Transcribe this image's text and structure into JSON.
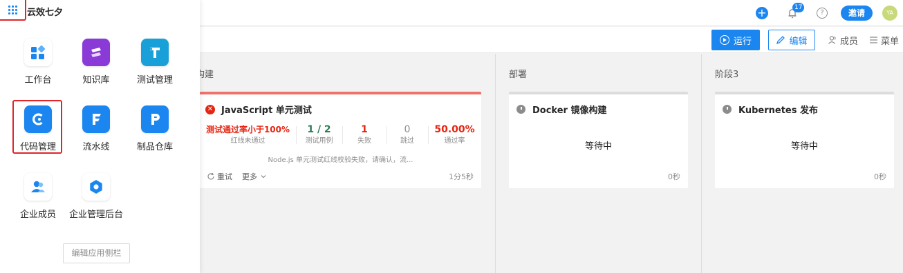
{
  "app": {
    "brand": "云效七夕"
  },
  "topbar": {
    "notification_count": "17",
    "help_glyph": "?",
    "invite_label": "邀请",
    "avatar_initials": "YA"
  },
  "toolbar": {
    "run_label": "运行",
    "edit_label": "编辑",
    "members_label": "成员",
    "menu_label": "菜单"
  },
  "drawer": {
    "apps": [
      {
        "label": "工作台",
        "icon": "workbench-icon"
      },
      {
        "label": "知识库",
        "icon": "knowledge-base-icon"
      },
      {
        "label": "测试管理",
        "icon": "test-management-icon"
      },
      {
        "label": "代码管理",
        "icon": "code-management-icon"
      },
      {
        "label": "流水线",
        "icon": "pipeline-icon"
      },
      {
        "label": "制品仓库",
        "icon": "artifact-repository-icon"
      },
      {
        "label": "企业成员",
        "icon": "enterprise-members-icon"
      },
      {
        "label": "企业管理后台",
        "icon": "enterprise-admin-icon"
      }
    ],
    "edit_sidebar_label": "编辑应用侧栏"
  },
  "stages": [
    {
      "title": "构建",
      "job": {
        "name": "JavaScript 单元测试",
        "status": "failed",
        "metrics": [
          {
            "value": "测试通过率小于100%",
            "label": "红线未通过",
            "color": "#e62412"
          },
          {
            "value": "1 / 2",
            "label": "测试用例",
            "color": "#2e7d52"
          },
          {
            "value": "1",
            "label": "失败",
            "color": "#e62412"
          },
          {
            "value": "0",
            "label": "跳过",
            "color": "#8c8c8c"
          },
          {
            "value": "50.00%",
            "label": "通过率",
            "color": "#e62412"
          }
        ],
        "message": "Node.js 单元测试红线校验失败，请确认，流...",
        "retry_label": "重试",
        "more_label": "更多",
        "duration": "1分5秒"
      }
    },
    {
      "title": "部署",
      "job": {
        "name": "Docker 镜像构建",
        "status_text": "等待中",
        "duration": "0秒"
      }
    },
    {
      "title": "阶段3",
      "job": {
        "name": "Kubernetes 发布",
        "status_text": "等待中",
        "duration": "0秒"
      }
    }
  ],
  "colors": {
    "accent": "#1b86f0",
    "error": "#e62412",
    "highlight": "#e0242a"
  }
}
